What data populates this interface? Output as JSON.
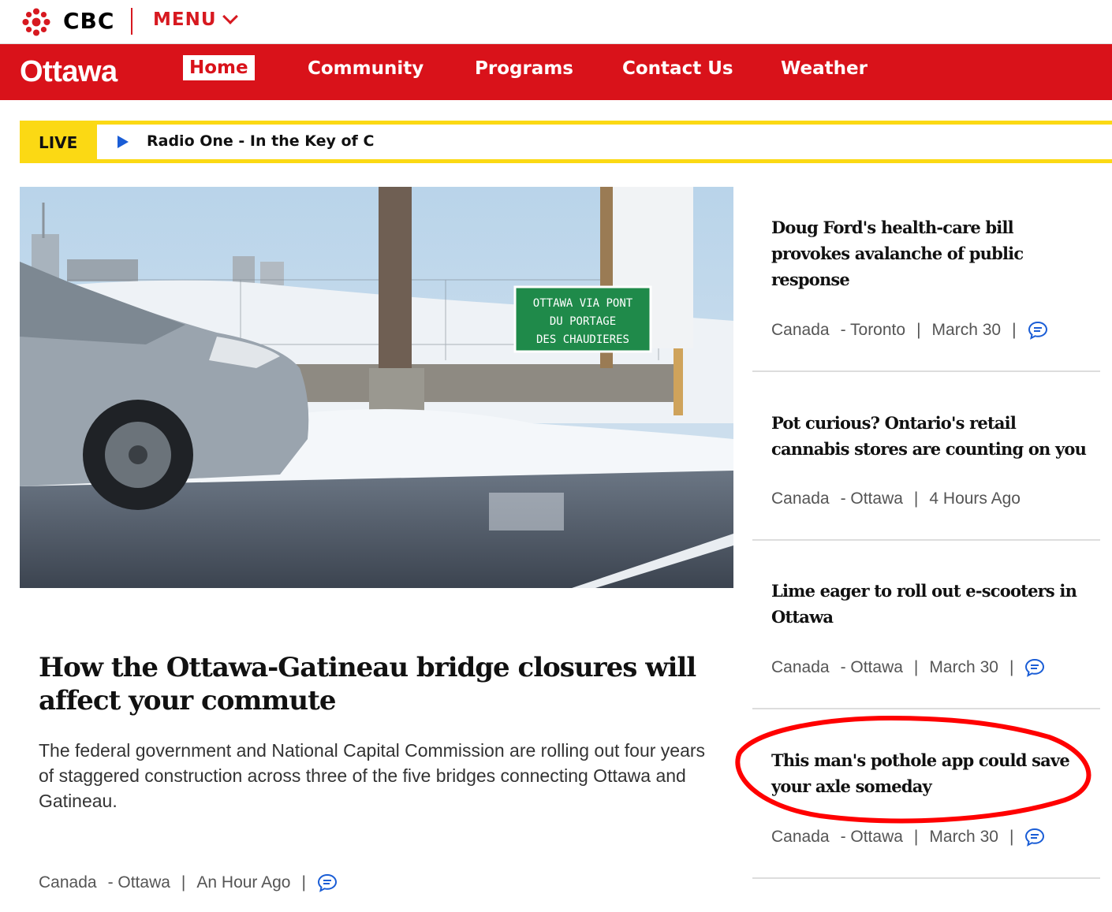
{
  "topbar": {
    "brand": "CBC",
    "menu_label": "MENU",
    "logo_icon": "cbc-gem-icon"
  },
  "nav": {
    "region": "Ottawa",
    "items": [
      {
        "label": "Home",
        "active": true
      },
      {
        "label": "Community",
        "active": false
      },
      {
        "label": "Programs",
        "active": false
      },
      {
        "label": "Contact Us",
        "active": false
      },
      {
        "label": "Weather",
        "active": false
      }
    ]
  },
  "live": {
    "label": "LIVE",
    "title": "Radio One - In the Key of C",
    "icon": "play-icon"
  },
  "hero": {
    "title": "How the Ottawa-Gatineau bridge closures will affect your commute",
    "description": "The federal government and National Capital Commission are rolling out four years of staggered construction across three of the five bridges connecting Ottawa and Gatineau.",
    "sign_lines": [
      "OTTAWA  VIA  PONT",
      "DU  PORTAGE",
      "DES  CHAUDIERES"
    ],
    "meta": {
      "country": "Canada",
      "city": "- Ottawa",
      "time": "An Hour Ago",
      "sep": "|"
    }
  },
  "stories": [
    {
      "title": "Doug Ford's health-care bill provokes avalanche of public response",
      "country": "Canada",
      "city": "- Toronto",
      "time": "March 30",
      "has_comments": true
    },
    {
      "title": "Pot curious? Ontario's retail cannabis stores are counting on you",
      "country": "Canada",
      "city": "- Ottawa",
      "time": "4 Hours Ago",
      "has_comments": false
    },
    {
      "title": "Lime eager to roll out e-scooters in Ottawa",
      "country": "Canada",
      "city": "- Ottawa",
      "time": "March 30",
      "has_comments": true
    },
    {
      "title": "This man's pothole app could save your axle someday",
      "country": "Canada",
      "city": "- Ottawa",
      "time": "March 30",
      "has_comments": true
    }
  ],
  "colors": {
    "brand_red": "#d9121a",
    "live_yellow": "#fbd914",
    "comment_blue": "#1a5dd6",
    "annotation_red": "#ff0000"
  }
}
